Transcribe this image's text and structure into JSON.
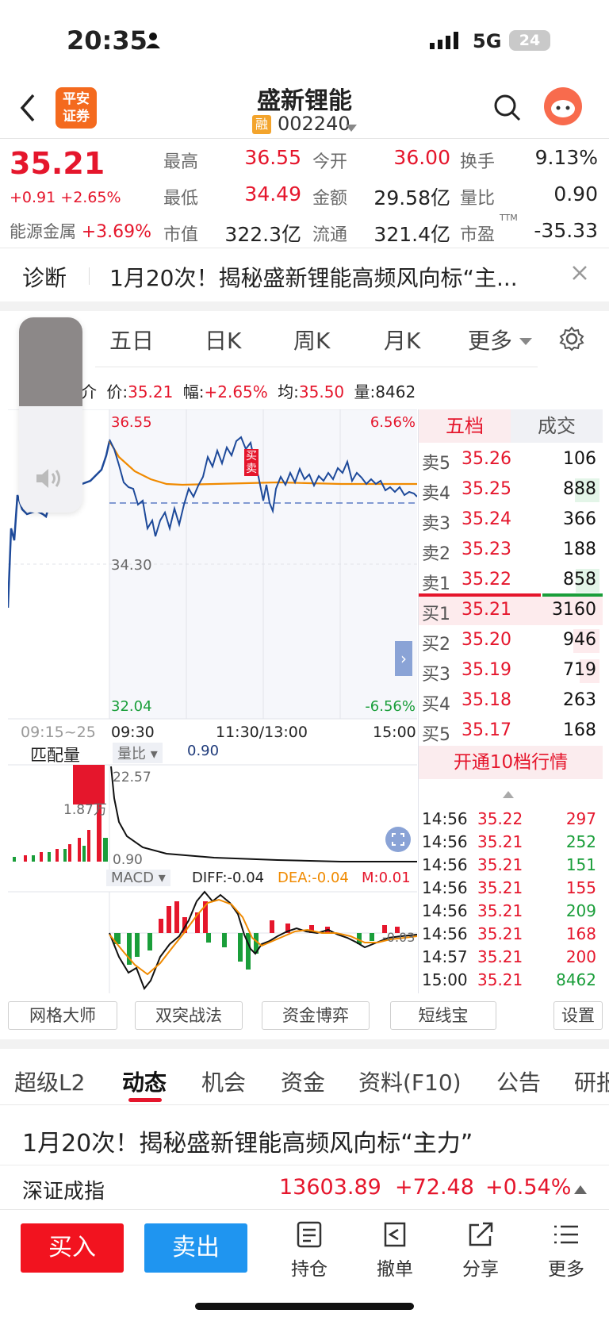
{
  "status_bar": {
    "time": "20:35",
    "signal_label": "5G",
    "battery": "24"
  },
  "header": {
    "broker_logo": "平安\n证券",
    "stock_name": "盛新锂能",
    "badge": "融",
    "stock_code": "002240"
  },
  "quote": {
    "price": "35.21",
    "change": "+0.91",
    "change_pct": "+2.65%",
    "sector": "能源金属",
    "sector_pct": "+3.69%",
    "stats": [
      {
        "label": "最高",
        "value": "36.55",
        "color": "red"
      },
      {
        "label": "今开",
        "value": "36.00",
        "color": "red"
      },
      {
        "label": "换手",
        "value": "9.13%",
        "color": "black"
      },
      {
        "label": "最低",
        "value": "34.49",
        "color": "red"
      },
      {
        "label": "金额",
        "value": "29.58亿",
        "color": "black"
      },
      {
        "label": "量比",
        "value": "0.90",
        "color": "black"
      },
      {
        "label": "市值",
        "value": "322.3亿",
        "color": "black"
      },
      {
        "label": "流通",
        "value": "321.4亿",
        "color": "black"
      },
      {
        "label": "市盈",
        "value": "-35.33",
        "color": "black"
      }
    ],
    "pe_suffix": "TTM"
  },
  "diagnosis": {
    "label": "诊断",
    "headline": "1月20次！揭秘盛新锂能高频风向标“主..."
  },
  "chart_tabs": [
    "五日",
    "日K",
    "周K",
    "月K",
    "更多"
  ],
  "info_line": {
    "price_label": "价:",
    "price": "35.21",
    "amp_label": "幅:",
    "amp": "+2.65%",
    "avg_label": "均:",
    "avg": "35.50",
    "vol_label": "量:",
    "vol": "8462",
    "prefix": "介"
  },
  "intraday": {
    "high_label": "36.55",
    "mid_label": "34.30",
    "low_label": "32.04",
    "high_pct": "6.56%",
    "low_pct": "-6.56%",
    "time_labels": [
      "09:15~25",
      "09:30",
      "11:30/13:00",
      "15:00"
    ],
    "tag": "买卖"
  },
  "volume_panel": {
    "title": "匹配量",
    "ratio_label": "量比",
    "ratio_value": "0.90",
    "top_value": "22.57",
    "bottom_value": "0.90",
    "left_value": "1.87万"
  },
  "macd": {
    "label": "MACD",
    "diff": "DIFF:-0.04",
    "dea": "DEA:-0.04",
    "m": "M:0.01",
    "tail": "-0.03"
  },
  "order_book": {
    "tabs": [
      "五档",
      "成交"
    ],
    "asks": [
      {
        "label": "卖5",
        "price": "35.26",
        "vol": "106",
        "bar": 0.0
      },
      {
        "label": "卖4",
        "price": "35.25",
        "vol": "888",
        "bar": 0.28
      },
      {
        "label": "卖3",
        "price": "35.24",
        "vol": "366",
        "bar": 0.0
      },
      {
        "label": "卖2",
        "price": "35.23",
        "vol": "188",
        "bar": 0.0
      },
      {
        "label": "卖1",
        "price": "35.22",
        "vol": "858",
        "bar": 0.27
      }
    ],
    "bids": [
      {
        "label": "买1",
        "price": "35.21",
        "vol": "3160",
        "bar": 1.0
      },
      {
        "label": "买2",
        "price": "35.20",
        "vol": "946",
        "bar": 0.3
      },
      {
        "label": "买3",
        "price": "35.19",
        "vol": "719",
        "bar": 0.23
      },
      {
        "label": "买4",
        "price": "35.18",
        "vol": "263",
        "bar": 0.0
      },
      {
        "label": "买5",
        "price": "35.17",
        "vol": "168",
        "bar": 0.0
      }
    ],
    "upgrade_button": "开通10档行情"
  },
  "trades": [
    {
      "time": "14:56",
      "price": "35.22",
      "vol": "297",
      "color": "red"
    },
    {
      "time": "14:56",
      "price": "35.21",
      "vol": "252",
      "color": "green"
    },
    {
      "time": "14:56",
      "price": "35.21",
      "vol": "151",
      "color": "green"
    },
    {
      "time": "14:56",
      "price": "35.21",
      "vol": "155",
      "color": "red"
    },
    {
      "time": "14:56",
      "price": "35.21",
      "vol": "209",
      "color": "green"
    },
    {
      "time": "14:56",
      "price": "35.21",
      "vol": "168",
      "color": "red"
    },
    {
      "time": "14:57",
      "price": "35.21",
      "vol": "200",
      "color": "red"
    },
    {
      "time": "15:00",
      "price": "35.21",
      "vol": "8462",
      "color": "green"
    }
  ],
  "tools": [
    "网格大师",
    "双突战法",
    "资金博弈",
    "短线宝",
    "设置"
  ],
  "section_tabs": [
    "超级L2",
    "动态",
    "机会",
    "资金",
    "资料(F10)",
    "公告",
    "研报"
  ],
  "news_headline": "1月20次！揭秘盛新锂能高频风向标“主力”",
  "index_bar": {
    "name": "深证成指",
    "value": "13603.89",
    "change": "+72.48",
    "pct": "+0.54%"
  },
  "bottom_bar": {
    "buy": "买入",
    "sell": "卖出",
    "items": [
      "持仓",
      "撤单",
      "分享",
      "更多"
    ]
  }
}
